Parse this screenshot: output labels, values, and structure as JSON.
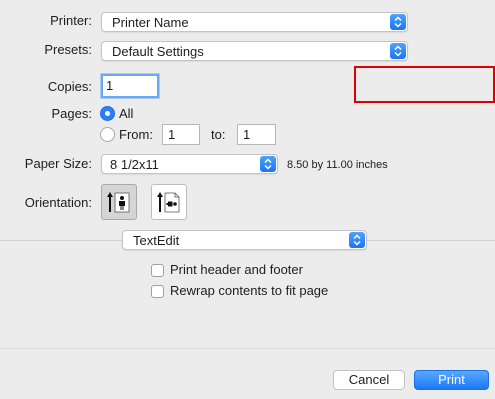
{
  "printer": {
    "label": "Printer:",
    "value": "Printer Name"
  },
  "presets": {
    "label": "Presets:",
    "value": "Default Settings"
  },
  "copies": {
    "label": "Copies:",
    "value": "1"
  },
  "pages": {
    "label": "Pages:",
    "all_label": "All",
    "from_label": "From:",
    "from_value": "1",
    "to_label": "to:",
    "to_value": "1",
    "selected": "All"
  },
  "paper_size": {
    "label": "Paper Size:",
    "value": "8 1/2x11",
    "dimensions": "8.50 by 11.00 inches"
  },
  "orientation": {
    "label": "Orientation:",
    "selected": "portrait"
  },
  "app_section": {
    "value": "TextEdit"
  },
  "options": [
    {
      "label": "Print header and footer",
      "checked": false
    },
    {
      "label": "Rewrap contents to fit page",
      "checked": false
    }
  ],
  "buttons": {
    "cancel": "Cancel",
    "print": "Print"
  },
  "colors": {
    "accent": "#1b77f6",
    "highlight_box": "#e00000",
    "background": "#ececec"
  },
  "icons": [
    "up-down-stepper-icon",
    "portrait-orientation-icon",
    "landscape-orientation-icon"
  ]
}
